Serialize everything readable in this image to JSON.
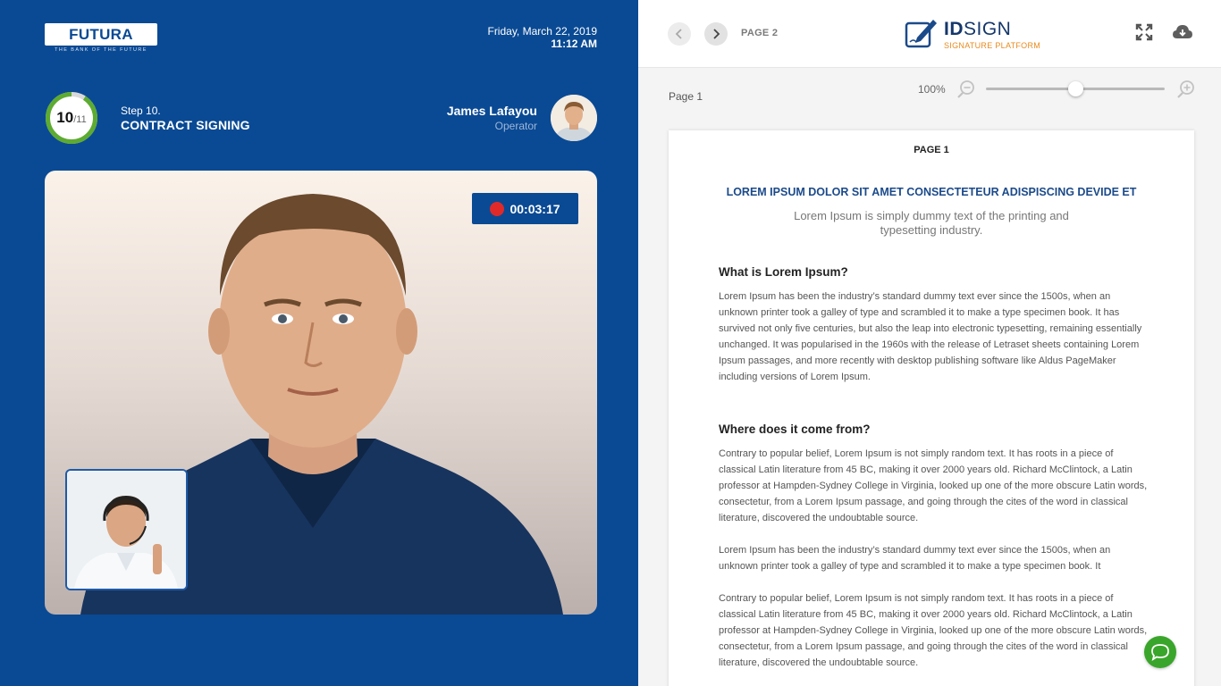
{
  "header": {
    "logo_text": "FUTURA BANK",
    "logo_tagline": "THE BANK OF THE FUTURE",
    "date": "Friday, March 22, 2019",
    "time": "11:12 AM"
  },
  "progress": {
    "current": "10",
    "total": "/11",
    "fraction": 0.909,
    "ring_color": "#5dab31"
  },
  "step": {
    "label": "Step 10.",
    "title": "CONTRACT SIGNING"
  },
  "operator": {
    "name": "James Lafayou",
    "role": "Operator"
  },
  "video": {
    "recording_time": "00:03:17"
  },
  "viewer": {
    "page_indicator": "PAGE 2",
    "brand_bold": "ID",
    "brand_rest": "SIGN",
    "brand_sub": "SIGNATURE PLATFORM",
    "current_page": "Page 1",
    "zoom_label": "100%",
    "zoom_level": 0.5
  },
  "document": {
    "page_header": "PAGE 1",
    "title": "LOREM IPSUM DOLOR SIT AMET CONSECTETEUR ADISPISCING DEVIDE ET",
    "subtitle": "Lorem Ipsum is simply dummy text of the printing and typesetting industry.",
    "section1_heading": "What is Lorem Ipsum?",
    "section1_body": "Lorem Ipsum has been the industry’s standard dummy text ever since the 1500s, when an unknown printer took a galley of type and scrambled it to make a type specimen book. It has survived not only five centuries, but also the leap into electronic typesetting, remaining essentially unchanged. It was popularised in the 1960s with the release of Letraset sheets containing Lorem Ipsum passages, and more recently with desktop publishing software like Aldus PageMaker including versions of Lorem Ipsum.",
    "section2_heading": "Where does it come from?",
    "section2_body1": "Contrary to popular belief, Lorem Ipsum is not simply random text. It has roots in a piece of classical Latin literature from 45 BC, making it over 2000 years old. Richard McClintock, a Latin professor at Hampden-Sydney College in Virginia, looked up one of the more obscure Latin words, consectetur, from a Lorem Ipsum passage, and going through the cites of the word in classical literature, discovered the undoubtable source.",
    "section2_body2": "Lorem Ipsum has been the industry’s standard dummy text ever since the 1500s, when an unknown printer took a galley of type and scrambled it to make a type specimen book. It",
    "section2_body3": "Contrary to popular belief, Lorem Ipsum is not simply random text. It has roots in a piece of classical Latin literature from 45 BC, making it over 2000 years old. Richard McClintock, a Latin professor at Hampden-Sydney College in Virginia, looked up one of the more obscure Latin words, consectetur, from a Lorem Ipsum passage, and going through the cites of the word in classical literature, discovered the undoubtable source."
  },
  "icons": {
    "prev": "chevron-left-icon",
    "next": "chevron-right-icon",
    "fullscreen": "fullscreen-icon",
    "download": "cloud-download-icon",
    "zoom_out": "zoom-out-icon",
    "zoom_in": "zoom-in-icon",
    "chat": "chat-icon",
    "brand": "signature-pen-icon"
  },
  "colors": {
    "primary": "#0a4a94",
    "accent": "#5dab31",
    "record": "#e02a2a",
    "brand_orange": "#e98a1e",
    "chat": "#3aa52b"
  }
}
